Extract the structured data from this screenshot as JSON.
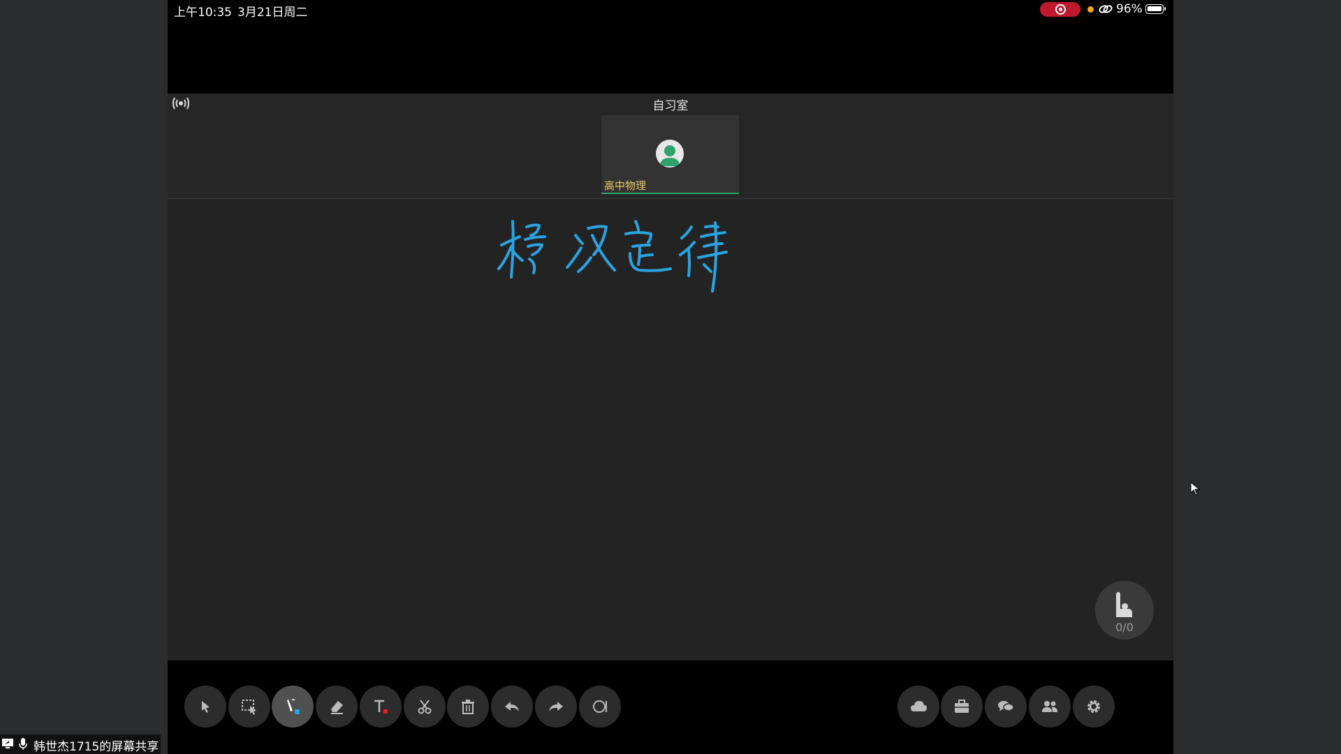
{
  "status_bar": {
    "time": "上午10:35",
    "date": "3月21日周二",
    "battery": "96%"
  },
  "meeting": {
    "room_title": "自习室",
    "participant": {
      "name": "高中物理",
      "avatar_icon": "user-avatar-icon"
    }
  },
  "whiteboard": {
    "handwriting_color": "#2ba3df",
    "raise_hand": {
      "icon": "raise-hand-icon",
      "count": "0/0"
    }
  },
  "toolbar": {
    "left_tools": [
      "select",
      "area-select",
      "pen",
      "eraser",
      "text",
      "scissors",
      "delete",
      "undo",
      "redo",
      "shape"
    ],
    "active_tool": "pen",
    "right_tools": [
      "cloud",
      "toolbox",
      "chat",
      "participants",
      "settings"
    ]
  },
  "share_banner": {
    "label": "韩世杰1715的屏幕共享"
  },
  "colors": {
    "recording": "#c0192e",
    "accent_green": "#2ea36b",
    "name_yellow": "#e8c766"
  }
}
